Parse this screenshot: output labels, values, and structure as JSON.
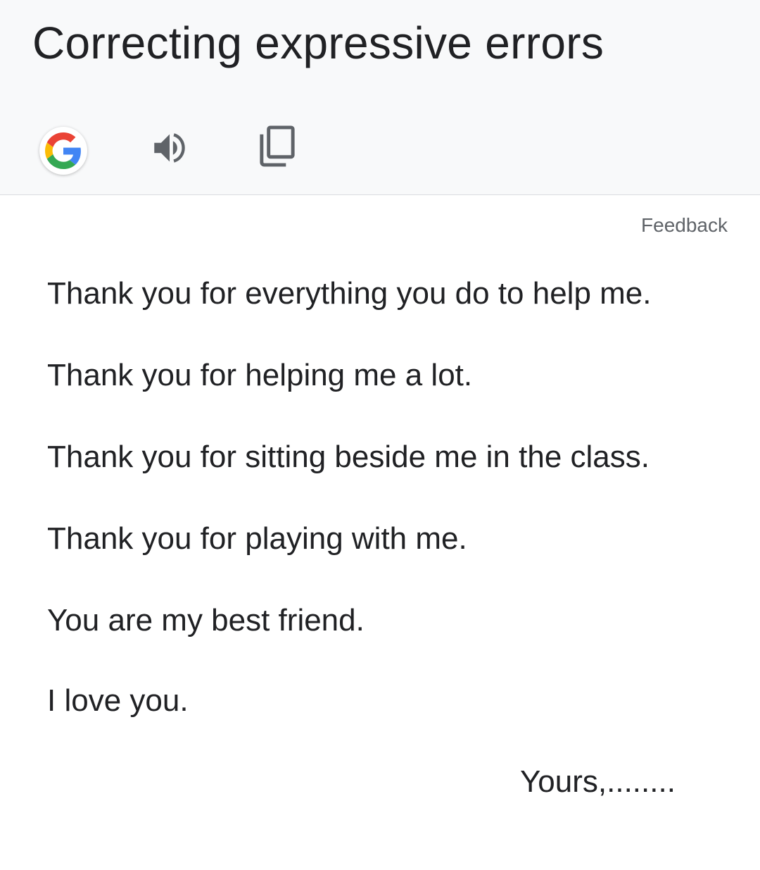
{
  "header": {
    "title": "Correcting expressive errors",
    "actions": {
      "google_icon": "google-g-icon",
      "speak_icon": "speaker-icon",
      "copy_icon": "copy-icon"
    }
  },
  "feedback_label": "Feedback",
  "letter": {
    "lines": [
      "Thank you for everything you do to help me.",
      "Thank you for helping me a lot.",
      "Thank you for sitting beside me in the class.",
      "Thank you for playing with me.",
      "You are my best friend.",
      "I love you."
    ],
    "signoff": "Yours,........"
  },
  "colors": {
    "header_bg": "#f8f9fa",
    "text": "#202124",
    "muted": "#5f6368",
    "google_blue": "#4285F4",
    "google_red": "#EA4335",
    "google_yellow": "#FBBC05",
    "google_green": "#34A853"
  }
}
